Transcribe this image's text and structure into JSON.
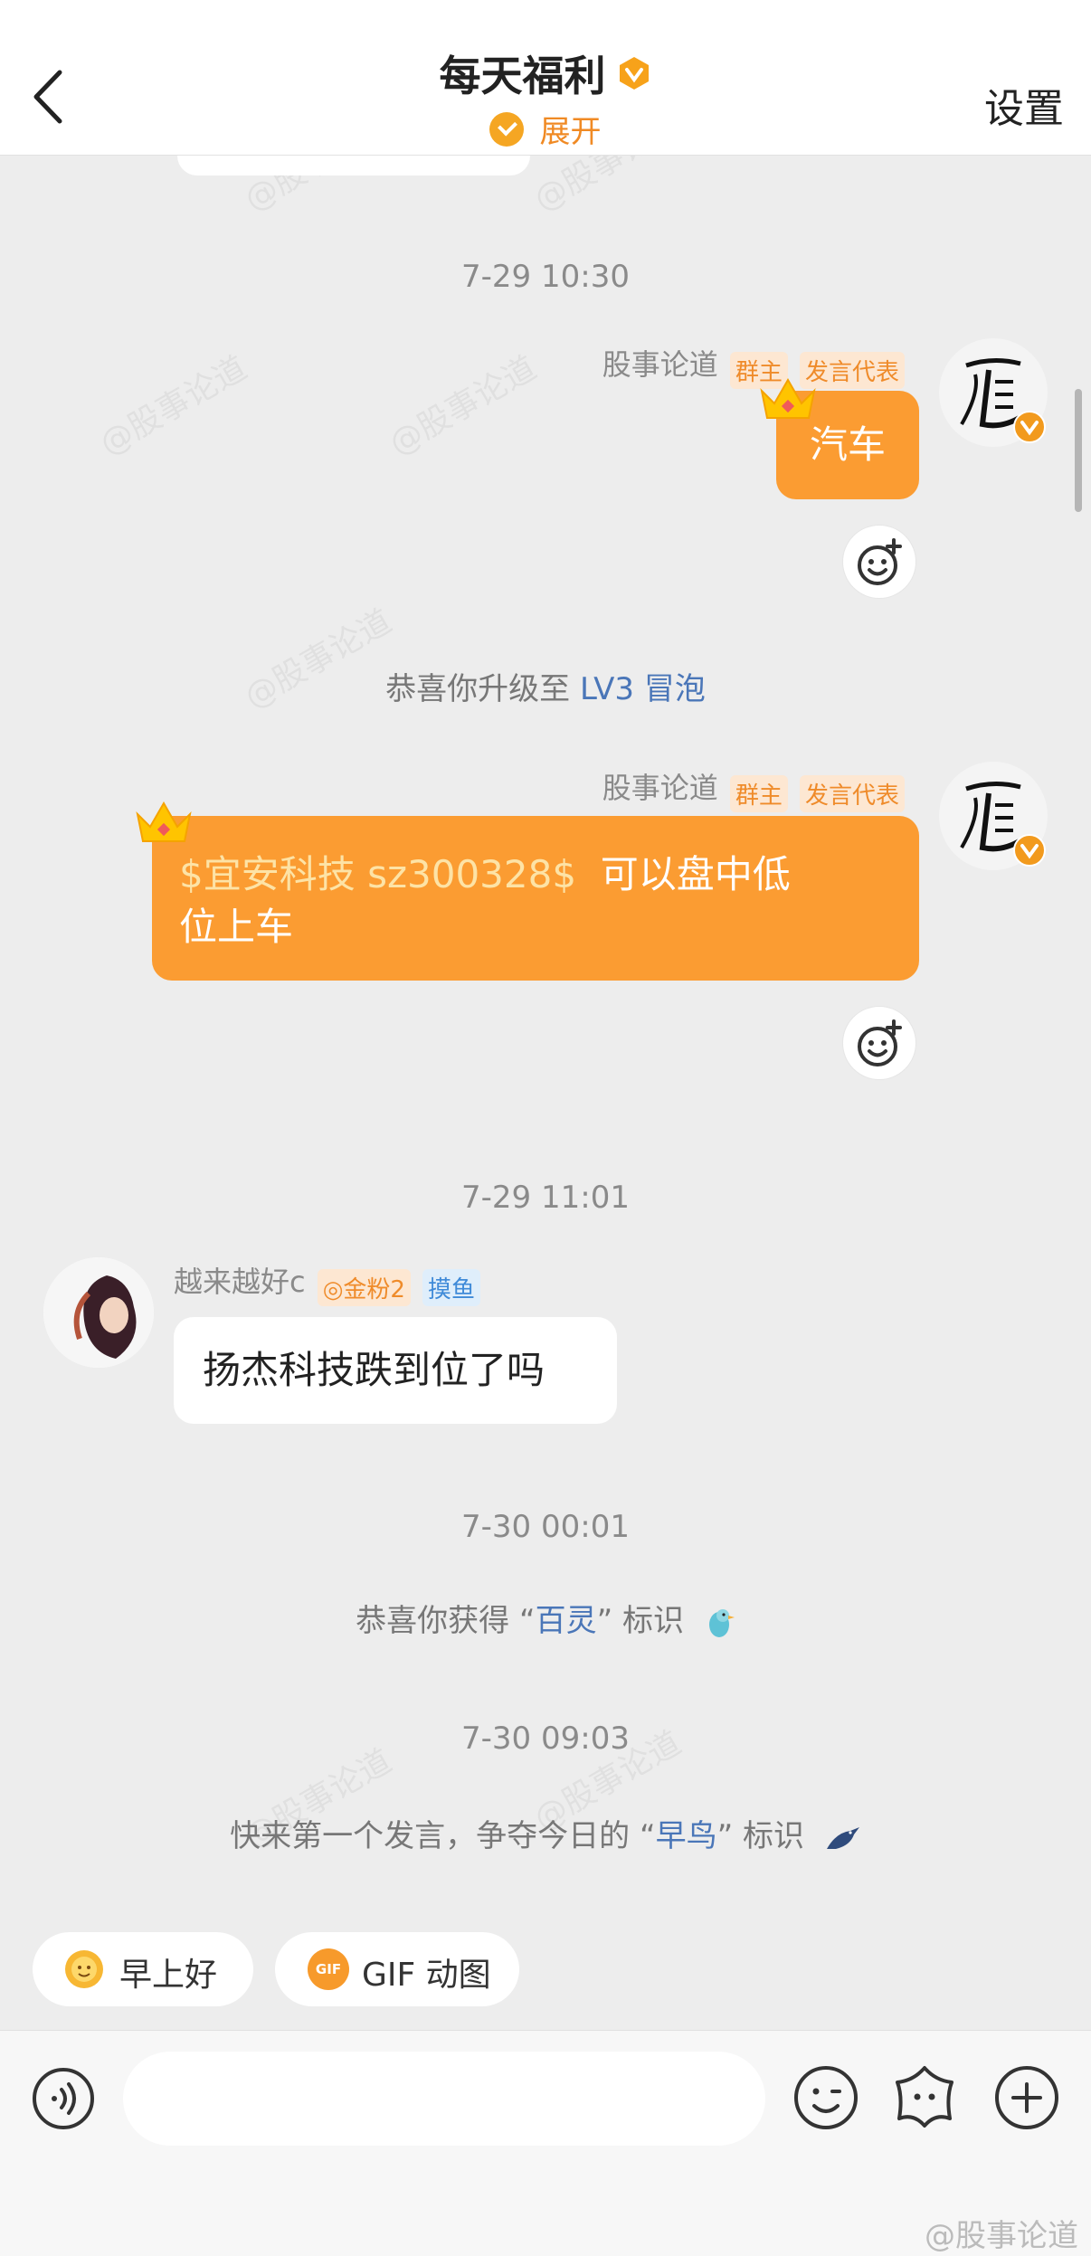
{
  "header": {
    "title": "每天福利",
    "expand_label": "展开",
    "settings_label": "设置"
  },
  "watermark": "@股事论道",
  "messages": [
    {
      "type": "timestamp",
      "text": "7-29 10:30"
    },
    {
      "type": "self",
      "name": "股事论道",
      "tags": [
        "群主",
        "发言代表"
      ],
      "text": "汽车"
    },
    {
      "type": "system",
      "prefix": "恭喜你升级至",
      "highlight": "LV3 冒泡",
      "suffix": ""
    },
    {
      "type": "self",
      "name": "股事论道",
      "tags": [
        "群主",
        "发言代表"
      ],
      "stock": "$宜安科技 sz300328$",
      "text_line1": "可以盘中低",
      "text_line2": "位上车"
    },
    {
      "type": "timestamp",
      "text": "7-29 11:01"
    },
    {
      "type": "other",
      "name": "越来越好c",
      "tags": [
        "金粉2",
        "摸鱼"
      ],
      "text": "扬杰科技跌到位了吗"
    },
    {
      "type": "timestamp",
      "text": "7-30 00:01"
    },
    {
      "type": "system",
      "prefix": "恭喜你获得 “",
      "highlight": "百灵",
      "suffix": "” 标识"
    },
    {
      "type": "timestamp",
      "text": "7-30 09:03"
    },
    {
      "type": "system",
      "prefix": "快来第一个发言，争夺今日的 “",
      "highlight": "早鸟",
      "suffix": "” 标识"
    }
  ],
  "quick_replies": [
    {
      "label": "早上好",
      "icon": "sun-emoji-icon"
    },
    {
      "label": "GIF 动图",
      "icon": "gif-icon",
      "icon_text": "GIF"
    }
  ],
  "input": {
    "placeholder": ""
  },
  "colors": {
    "accent": "#fb9c32",
    "link": "#4a76b8",
    "background": "#ededed"
  }
}
